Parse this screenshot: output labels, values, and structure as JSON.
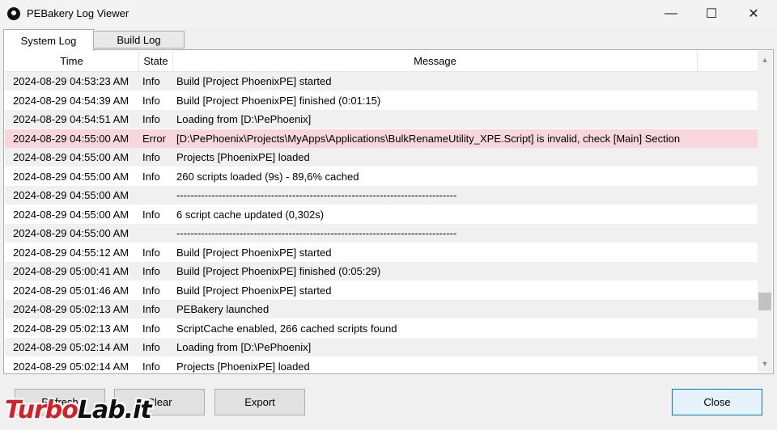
{
  "window": {
    "title": "PEBakery Log Viewer",
    "controls": {
      "minimize": "—",
      "maximize": "☐",
      "close": "✕"
    }
  },
  "tabs": [
    {
      "label": "System Log",
      "active": true
    },
    {
      "label": "Build Log",
      "active": false
    }
  ],
  "log": {
    "columns": [
      "Time",
      "State",
      "Message"
    ],
    "rows": [
      {
        "time": "2024-08-29 04:53:23 AM",
        "state": "Info",
        "message": "Build [Project PhoenixPE] started"
      },
      {
        "time": "2024-08-29 04:54:39 AM",
        "state": "Info",
        "message": "Build [Project PhoenixPE] finished (0:01:15)"
      },
      {
        "time": "2024-08-29 04:54:51 AM",
        "state": "Info",
        "message": "Loading from [D:\\PePhoenix]"
      },
      {
        "time": "2024-08-29 04:55:00 AM",
        "state": "Error",
        "message": "[D:\\PePhoenix\\Projects\\MyApps\\Applications\\BulkRenameUtility_XPE.Script] is invalid, check [Main] Section"
      },
      {
        "time": "2024-08-29 04:55:00 AM",
        "state": "Info",
        "message": "Projects [PhoenixPE] loaded"
      },
      {
        "time": "2024-08-29 04:55:00 AM",
        "state": "Info",
        "message": "260 scripts loaded (9s) - 89,6% cached"
      },
      {
        "time": "2024-08-29 04:55:00 AM",
        "state": "",
        "message": "--------------------------------------------------------------------------------"
      },
      {
        "time": "2024-08-29 04:55:00 AM",
        "state": "Info",
        "message": "6 script cache updated (0,302s)"
      },
      {
        "time": "2024-08-29 04:55:00 AM",
        "state": "",
        "message": "--------------------------------------------------------------------------------"
      },
      {
        "time": "2024-08-29 04:55:12 AM",
        "state": "Info",
        "message": "Build [Project PhoenixPE] started"
      },
      {
        "time": "2024-08-29 05:00:41 AM",
        "state": "Info",
        "message": "Build [Project PhoenixPE] finished (0:05:29)"
      },
      {
        "time": "2024-08-29 05:01:46 AM",
        "state": "Info",
        "message": "Build [Project PhoenixPE] started"
      },
      {
        "time": "2024-08-29 05:02:13 AM",
        "state": "Info",
        "message": "PEBakery launched"
      },
      {
        "time": "2024-08-29 05:02:13 AM",
        "state": "Info",
        "message": "ScriptCache enabled, 266 cached scripts found"
      },
      {
        "time": "2024-08-29 05:02:14 AM",
        "state": "Info",
        "message": "Loading from [D:\\PePhoenix]"
      },
      {
        "time": "2024-08-29 05:02:14 AM",
        "state": "Info",
        "message": "Projects [PhoenixPE] loaded"
      }
    ],
    "scroll_position": 0.83
  },
  "buttons": {
    "refresh": "Refresh",
    "clear": "Clear",
    "export": "Export",
    "close": "Close"
  },
  "colors": {
    "row_alt": "#f0f0f0",
    "row_error": "#f8d7dc",
    "accent": "#0078d7"
  },
  "watermark": {
    "brand_a": "Turbo",
    "brand_b": "Lab.it"
  }
}
